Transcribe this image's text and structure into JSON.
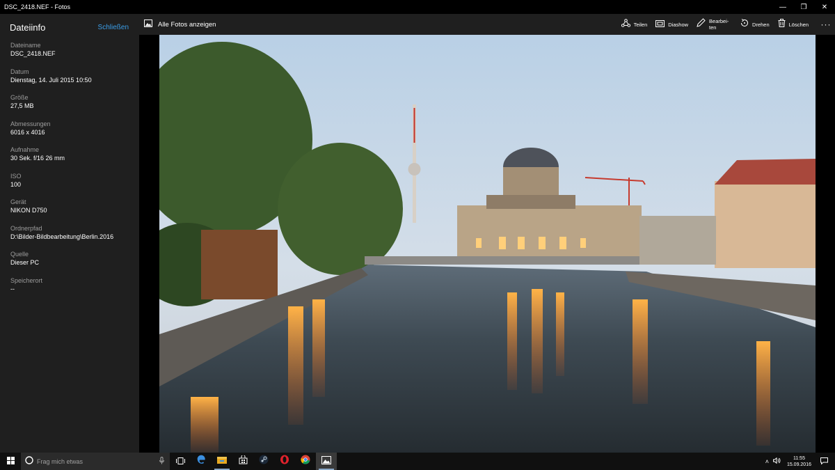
{
  "window": {
    "title": "DSC_2418.NEF - Fotos",
    "minimize": "—",
    "maximize": "❐",
    "close": "✕"
  },
  "sidebar": {
    "title": "Dateiinfo",
    "close_label": "Schließen",
    "items": [
      {
        "label": "Dateiname",
        "value": "DSC_2418.NEF"
      },
      {
        "label": "Datum",
        "value": "Dienstag, 14. Juli 2015 10:50"
      },
      {
        "label": "Größe",
        "value": "27,5 MB"
      },
      {
        "label": "Abmessungen",
        "value": "6016 x 4016"
      },
      {
        "label": "Aufnahme",
        "value": "30 Sek. f/16 26 mm"
      },
      {
        "label": "ISO",
        "value": "100"
      },
      {
        "label": "Gerät",
        "value": "NIKON D750"
      },
      {
        "label": "Ordnerpfad",
        "value": "D:\\Bilder-Bildbearbeitung\\Berlin.2016"
      },
      {
        "label": "Quelle",
        "value": "Dieser PC"
      },
      {
        "label": "Speicherort",
        "value": "--"
      }
    ]
  },
  "toolbar": {
    "all_photos_label": "Alle Fotos anzeigen",
    "share_label": "Teilen",
    "slideshow_label": "Diashow",
    "edit_label": "Bearbei-ten",
    "rotate_label": "Drehen",
    "delete_label": "Löschen",
    "more_label": "···"
  },
  "taskbar": {
    "search_placeholder": "Frag mich etwas",
    "time": "11:55",
    "date": "15.09.2016",
    "apps": [
      "edge-icon",
      "file-explorer-icon",
      "store-icon",
      "steam-icon",
      "opera-icon",
      "chrome-icon",
      "photos-icon"
    ]
  },
  "colors": {
    "accent": "#3b9ee8",
    "sidebar_bg": "#1f1f1f",
    "taskbar_bg": "#101010"
  }
}
